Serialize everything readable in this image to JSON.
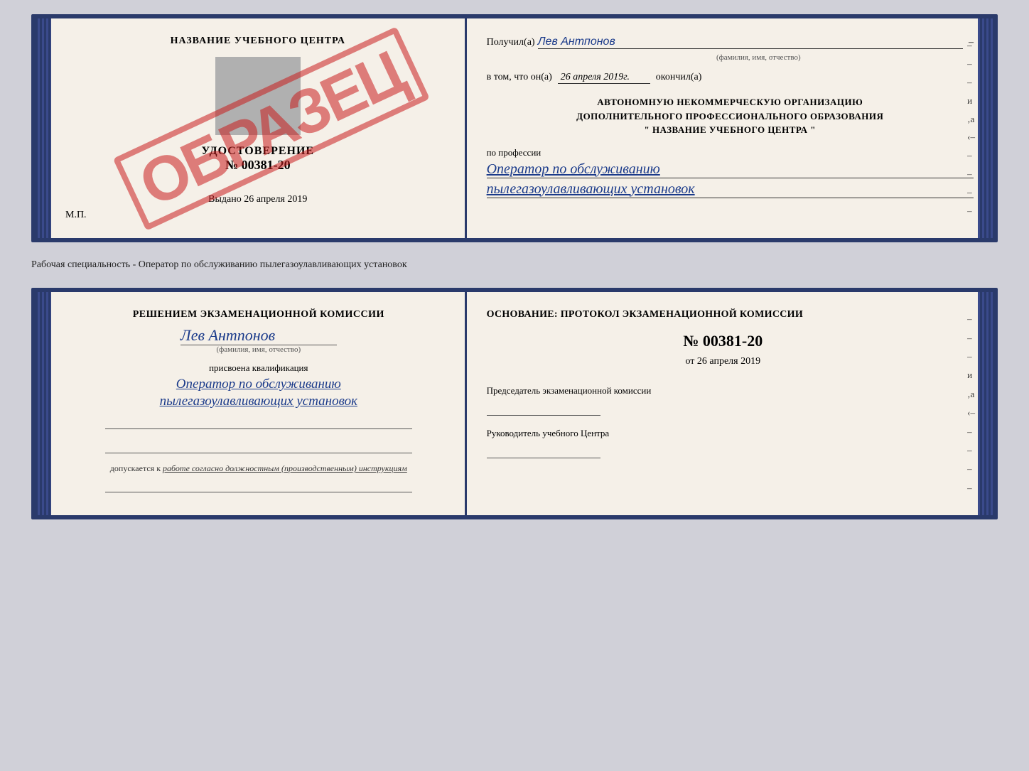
{
  "top_section": {
    "left": {
      "center_title": "НАЗВАНИЕ УЧЕБНОГО ЦЕНТРА",
      "cert_label": "УДОСТОВЕРЕНИЕ",
      "cert_number": "№ 00381-20",
      "issued": "Выдано",
      "issued_date": "26 апреля 2019",
      "mp": "М.П."
    },
    "stamp": "ОБРАЗЕЦ",
    "right": {
      "received_label": "Получил(а)",
      "received_name": "Лев Антпонов",
      "fio_hint": "(фамилия, имя, отчество)",
      "date_prefix": "в том, что он(а)",
      "date_value": "26 апреля 2019г.",
      "date_suffix": "окончил(а)",
      "org_line1": "АВТОНОМНУЮ НЕКОММЕРЧЕСКУЮ ОРГАНИЗАЦИЮ",
      "org_line2": "ДОПОЛНИТЕЛЬНОГО ПРОФЕССИОНАЛЬНОГО ОБРАЗОВАНИЯ",
      "org_line3": "\"   НАЗВАНИЕ УЧЕБНОГО ЦЕНТРА   \"",
      "profession_label": "по профессии",
      "profession_line1": "Оператор по обслуживанию",
      "profession_line2": "пылегазоулавливающих установок"
    }
  },
  "separator": {
    "label": "Рабочая специальность - Оператор по обслуживанию пылегазоулавливающих установок"
  },
  "bottom_section": {
    "left": {
      "decision_text": "Решением экзаменационной комиссии",
      "person_name": "Лев Антпонов",
      "fio_hint": "(фамилия, имя, отчество)",
      "qual_label": "присвоена квалификация",
      "qual_line1": "Оператор по обслуживанию",
      "qual_line2": "пылегазоулавливающих установок",
      "allowed_prefix": "допускается к",
      "allowed_text": "работе согласно должностным (производственным) инструкциям"
    },
    "right": {
      "basis_label": "Основание: протокол экзаменационной комиссии",
      "protocol_number": "№ 00381-20",
      "from_date_prefix": "от",
      "from_date": "26 апреля 2019",
      "chairman_label": "Председатель экзаменационной комиссии",
      "center_head_label": "Руководитель учебного Центра"
    },
    "side_dashes": [
      "–",
      "–",
      "–",
      "и",
      "‚а",
      "‹–",
      "–",
      "–",
      "–",
      "–"
    ]
  }
}
